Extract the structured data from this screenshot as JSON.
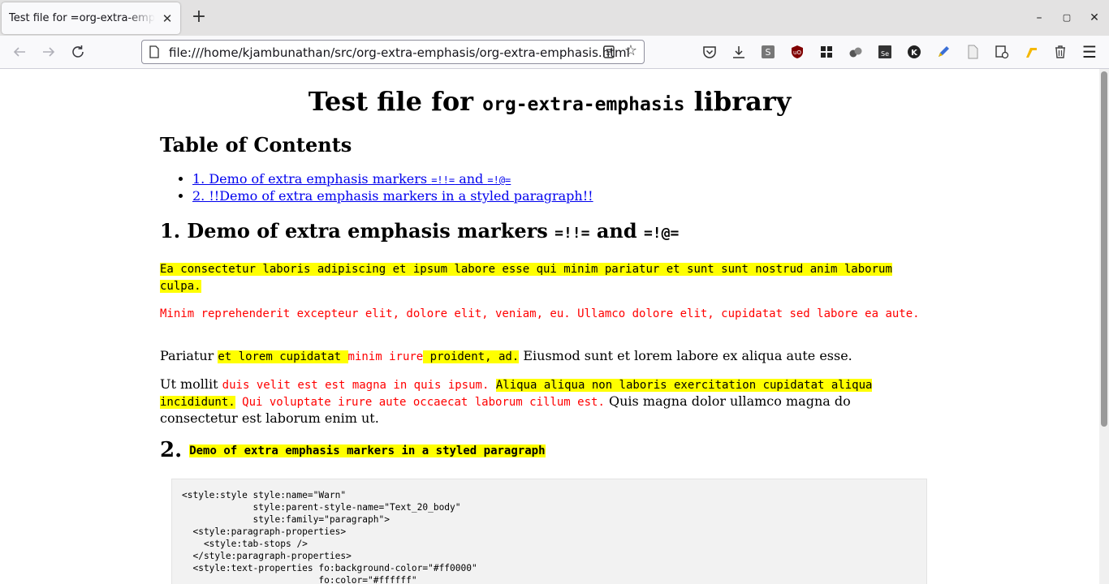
{
  "browser": {
    "tab_title": "Test file for =org-extra-emphasis",
    "tab_close": "✕",
    "new_tab": "+",
    "window_controls": {
      "minimize": "–",
      "maximize": "▢",
      "close": "✕"
    },
    "url": "file:///home/kjambunathan/src/org-extra-emphasis/org-extra-emphasis.html",
    "toolbar_icons": [
      "pocket-icon",
      "download-icon",
      "extension-s-icon",
      "ublock-icon",
      "grid-icon",
      "circles-icon",
      "selenium-icon",
      "k-icon",
      "pencil-icon",
      "document-icon",
      "library-icon",
      "boomerang-icon",
      "trash-icon"
    ],
    "menu_icon": "☰"
  },
  "page": {
    "title_pre": "Test file for ",
    "title_code": "org-extra-emphasis",
    "title_post": " library",
    "toc_heading": "Table of Contents",
    "toc_items": [
      {
        "text": "1. Demo of extra emphasis markers ",
        "code1": "=!!=",
        "mid": " and ",
        "code2": "=!@="
      },
      {
        "text": "2. !!Demo of extra emphasis markers in a styled paragraph!!"
      }
    ],
    "section1": {
      "number": "1. ",
      "text": "Demo of extra emphasis markers ",
      "code1": "=!!=",
      "mid": " and ",
      "code2": "=!@="
    },
    "p1": "Ea consectetur laboris adipiscing et ipsum labore esse qui minim pariatur et sunt sunt nostrud anim laborum culpa.",
    "p2": "Minim reprehenderit excepteur elit, dolore elit, veniam, eu. Ullamco dolore elit, cupidatat sed labore ea aute.",
    "p3": {
      "a": "Pariatur ",
      "b": "et lorem cupidatat ",
      "c": "minim irure",
      "d": " proident, ad.",
      "e": " Eiusmod sunt et lorem labore ex aliqua aute esse."
    },
    "p4": {
      "a": "Ut mollit ",
      "b": "duis velit est est magna in quis ipsum.",
      "c": " ",
      "d": "Aliqua aliqua non laboris exercitation cupidatat aliqua incididunt.",
      "e": " ",
      "f": "Qui voluptate irure aute occaecat laborum cillum est.",
      "g": " Quis magna dolor ullamco magna do consectetur est laborum enim ut."
    },
    "section2": {
      "number": "2. ",
      "text": "Demo of extra emphasis markers in a styled paragraph"
    },
    "code": "<style:style style:name=\"Warn\"\n             style:parent-style-name=\"Text_20_body\"\n             style:family=\"paragraph\">\n  <style:paragraph-properties>\n    <style:tab-stops />\n  </style:paragraph-properties>\n  <style:text-properties fo:background-color=\"#ff0000\"\n                         fo:color=\"#ffffff\""
  }
}
